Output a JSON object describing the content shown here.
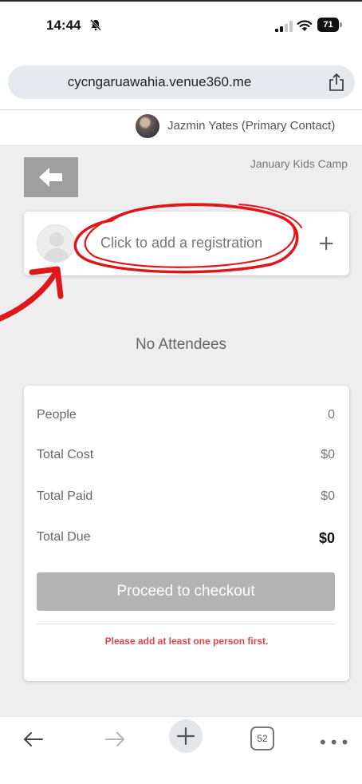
{
  "status_bar": {
    "time": "14:44",
    "battery": "71"
  },
  "browser": {
    "url": "cycngaruawahia.venue360.me"
  },
  "contact": {
    "name": "Jazmin Yates (Primary Contact)"
  },
  "page": {
    "event_title": "January Kids Camp",
    "registration_prompt": "Click to add a registration",
    "add_symbol": "+",
    "no_attendees": "No Attendees"
  },
  "summary": {
    "rows": [
      {
        "label": "People",
        "value": "0"
      },
      {
        "label": "Total Cost",
        "value": "$0"
      },
      {
        "label": "Total Paid",
        "value": "$0"
      },
      {
        "label": "Total Due",
        "value": "$0"
      }
    ],
    "checkout_label": "Proceed to checkout",
    "warning": "Please add at least one person first."
  },
  "toolbar": {
    "tab_count": "52"
  },
  "colors": {
    "annotation": "#e0161b",
    "warning": "#e04646",
    "page_background": "#eeeeee",
    "button_disabled": "#b3b3b3"
  }
}
